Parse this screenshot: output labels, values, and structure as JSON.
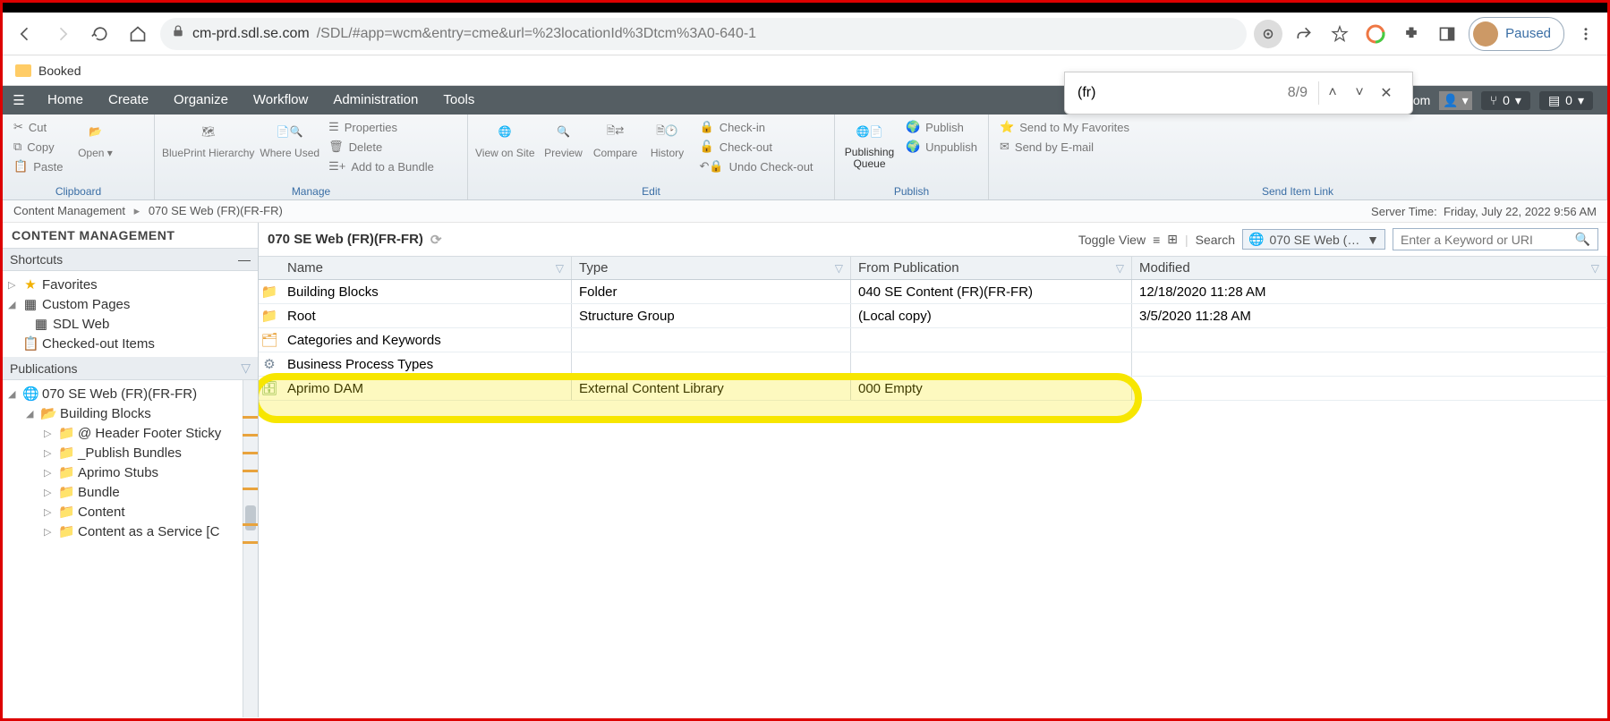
{
  "browser": {
    "url_host": "cm-prd.sdl.se.com",
    "url_path": "/SDL/#app=wcm&entry=cme&url=%23locationId%3Dtcm%3A0-640-1",
    "paused_label": "Paused",
    "find_value": "(fr)",
    "find_count": "8/9"
  },
  "bookmarks": {
    "first": "Booked"
  },
  "menubar": {
    "items": [
      "Home",
      "Create",
      "Organize",
      "Workflow",
      "Administration",
      "Tools"
    ],
    "user": "Navneet.tyagi@se.com",
    "counter1": "0",
    "counter2": "0"
  },
  "ribbon": {
    "clipboard": {
      "cut": "Cut",
      "copy": "Copy",
      "paste": "Paste",
      "open": "Open",
      "label": "Clipboard"
    },
    "manage": {
      "blueprint": "BluePrint Hierarchy",
      "where": "Where Used",
      "properties": "Properties",
      "delete": "Delete",
      "bundle": "Add to a Bundle",
      "label": "Manage"
    },
    "edit": {
      "viewsite": "View on Site",
      "preview": "Preview",
      "compare": "Compare",
      "history": "History",
      "checkin": "Check-in",
      "checkout": "Check-out",
      "undo": "Undo Check-out",
      "label": "Edit"
    },
    "publish": {
      "queue": "Publishing Queue",
      "publish": "Publish",
      "unpublish": "Unpublish",
      "label": "Publish"
    },
    "send": {
      "fav": "Send to My Favorites",
      "email": "Send by E-mail",
      "label": "Send Item Link"
    }
  },
  "breadcrumb": {
    "root": "Content Management",
    "loc": "070 SE Web (FR)(FR-FR)",
    "servertime_label": "Server Time:",
    "servertime": "Friday, July 22, 2022 9:56 AM"
  },
  "leftpane": {
    "title": "CONTENT MANAGEMENT",
    "shortcuts_h": "Shortcuts",
    "favorites": "Favorites",
    "custompages": "Custom Pages",
    "sdlweb": "SDL Web",
    "checkedout": "Checked-out Items",
    "publications_h": "Publications",
    "pub_root": "070 SE Web (FR)(FR-FR)",
    "building_blocks": "Building Blocks",
    "tree": [
      "@ Header Footer Sticky",
      "_Publish Bundles",
      "Aprimo Stubs",
      "Bundle",
      "Content",
      "Content as a Service [C"
    ]
  },
  "listing": {
    "title": "070 SE Web (FR)(FR-FR)",
    "toggle": "Toggle View",
    "search_label": "Search",
    "scope": "070 SE Web (FR...",
    "search_placeholder": "Enter a Keyword or URI",
    "cols": {
      "name": "Name",
      "type": "Type",
      "from": "From Publication",
      "mod": "Modified"
    },
    "rows": [
      {
        "icon": "folder",
        "name": "Building Blocks",
        "type": "Folder",
        "from": "040 SE Content (FR)(FR-FR)",
        "mod": "12/18/2020 11:28 AM"
      },
      {
        "icon": "sgroup",
        "name": "Root",
        "type": "Structure Group",
        "from": "(Local copy)",
        "mod": "3/5/2020 11:28 AM"
      },
      {
        "icon": "cat",
        "name": "Categories and Keywords",
        "type": "",
        "from": "",
        "mod": ""
      },
      {
        "icon": "bpt",
        "name": "Business Process Types",
        "type": "",
        "from": "",
        "mod": ""
      },
      {
        "icon": "ecl",
        "name": "Aprimo DAM",
        "type": "External Content Library",
        "from": "000 Empty",
        "mod": ""
      }
    ]
  }
}
